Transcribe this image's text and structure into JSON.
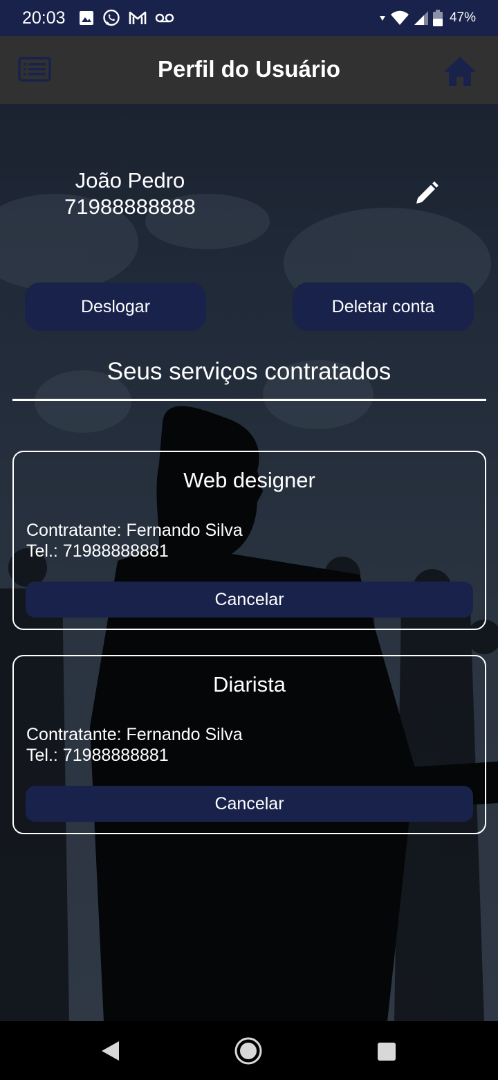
{
  "status_bar": {
    "time": "20:03",
    "battery_percent": "47%",
    "left_icons": [
      "image-icon",
      "whatsapp-icon",
      "gmail-icon",
      "voicemail-icon"
    ],
    "right_icons": [
      "wifi-icon",
      "cell-signal-icon",
      "battery-icon"
    ]
  },
  "header": {
    "title": "Perfil do Usuário",
    "left_icon": "menu-list-icon",
    "right_icon": "home-icon"
  },
  "profile": {
    "name": "João Pedro",
    "phone": "71988888888",
    "edit_icon": "pencil-icon"
  },
  "actions": {
    "logout_label": "Deslogar",
    "delete_label": "Deletar conta"
  },
  "services_section": {
    "title": "Seus serviços contratados",
    "items": [
      {
        "title": "Web designer",
        "contractor": "Contratante: Fernando Silva",
        "phone": "Tel.: 71988888881",
        "cancel_label": "Cancelar"
      },
      {
        "title": "Diarista",
        "contractor": "Contratante: Fernando Silva",
        "phone": "Tel.: 71988888881",
        "cancel_label": "Cancelar"
      }
    ]
  },
  "nav_bar": {
    "icons": [
      "back-triangle-icon",
      "home-circle-icon",
      "recents-square-icon"
    ]
  },
  "colors": {
    "primary_navy": "#19224a",
    "header_gray": "#313131",
    "text": "#ffffff",
    "nav_bar": "#000000"
  }
}
